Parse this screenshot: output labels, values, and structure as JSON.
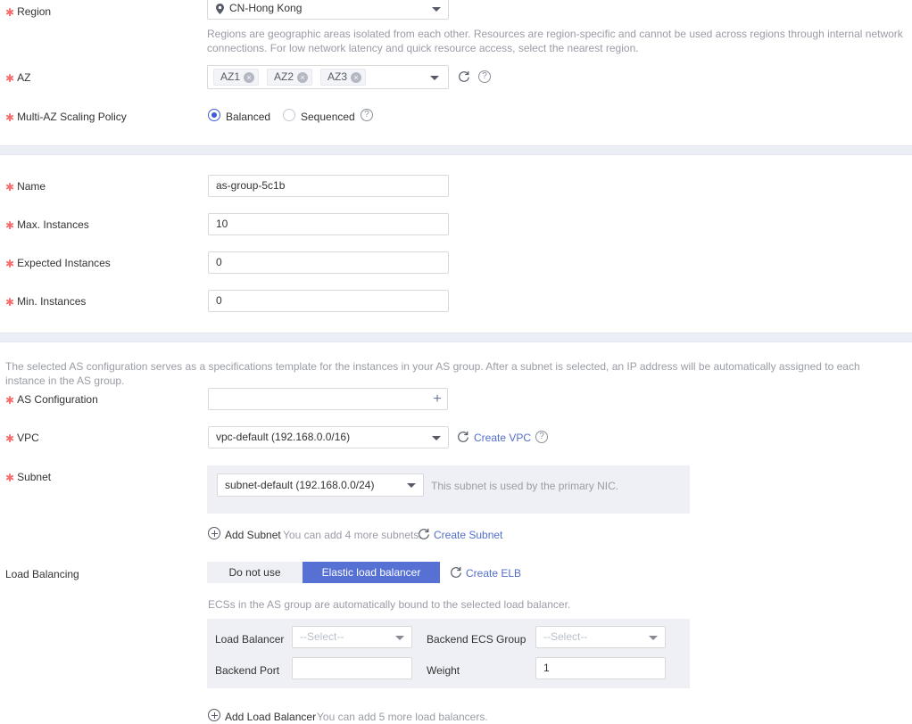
{
  "form": {
    "region": {
      "label": "Region",
      "required": true,
      "value": "CN-Hong Kong",
      "icon": "location-pin-icon",
      "description": "Regions are geographic areas isolated from each other. Resources are region-specific and cannot be used across regions through internal network connections. For low network latency and quick resource access, select the nearest region."
    },
    "az": {
      "label": "AZ",
      "required": true,
      "tags": [
        "AZ1",
        "AZ2",
        "AZ3"
      ],
      "remove_glyph": "×",
      "refresh_icon": "refresh-icon",
      "help_icon": "help-icon"
    },
    "multi_az_policy": {
      "label": "Multi-AZ Scaling Policy",
      "required": true,
      "options": [
        "Balanced",
        "Sequenced"
      ],
      "selected": "Balanced",
      "help_icon": "help-icon"
    },
    "name": {
      "label": "Name",
      "required": true,
      "value": "as-group-5c1b"
    },
    "max_instances": {
      "label": "Max. Instances",
      "required": true,
      "value": "10"
    },
    "expected_instances": {
      "label": "Expected Instances",
      "required": true,
      "value": "0"
    },
    "min_instances": {
      "label": "Min. Instances",
      "required": true,
      "value": "0"
    },
    "as_config_note": "The selected AS configuration serves as a specifications template for the instances in your AS group. After a subnet is selected, an IP address will be automatically assigned to each instance in the AS group.",
    "as_configuration": {
      "label": "AS Configuration",
      "required": true,
      "value": "",
      "add_glyph": "+"
    },
    "vpc": {
      "label": "VPC",
      "required": true,
      "value": "vpc-default (192.168.0.0/16)",
      "refresh_icon": "refresh-icon",
      "create_link": "Create VPC",
      "help_icon": "help-icon"
    },
    "subnet": {
      "label": "Subnet",
      "required": true,
      "value": "subnet-default (192.168.0.0/24)",
      "note": "This subnet is used by the primary NIC.",
      "add_label": "Add Subnet",
      "add_hint": "You can add 4 more subnets.",
      "refresh_icon": "refresh-icon",
      "create_link": "Create Subnet",
      "add_icon": "plus-circle-icon"
    },
    "load_balancing": {
      "label": "Load Balancing",
      "required": false,
      "options": [
        "Do not use",
        "Elastic load balancer"
      ],
      "selected": "Elastic load balancer",
      "refresh_icon": "refresh-icon",
      "create_link": "Create ELB",
      "note": "ECSs in the AS group are automatically bound to the selected load balancer.",
      "fields": {
        "load_balancer_label": "Load Balancer",
        "load_balancer_value": "--Select--",
        "backend_ecs_group_label": "Backend ECS Group",
        "backend_ecs_group_value": "--Select--",
        "backend_port_label": "Backend Port",
        "backend_port_value": "",
        "weight_label": "Weight",
        "weight_value": "1"
      },
      "add_label": "Add Load Balancer",
      "add_hint": "You can add 5 more load balancers.",
      "add_icon": "plus-circle-icon"
    }
  },
  "colors": {
    "accent": "#5670d4",
    "link": "#526ecc",
    "required_star": "#f56c6c",
    "panel_bg": "#eef0f5",
    "band_bg": "#eceef5"
  }
}
